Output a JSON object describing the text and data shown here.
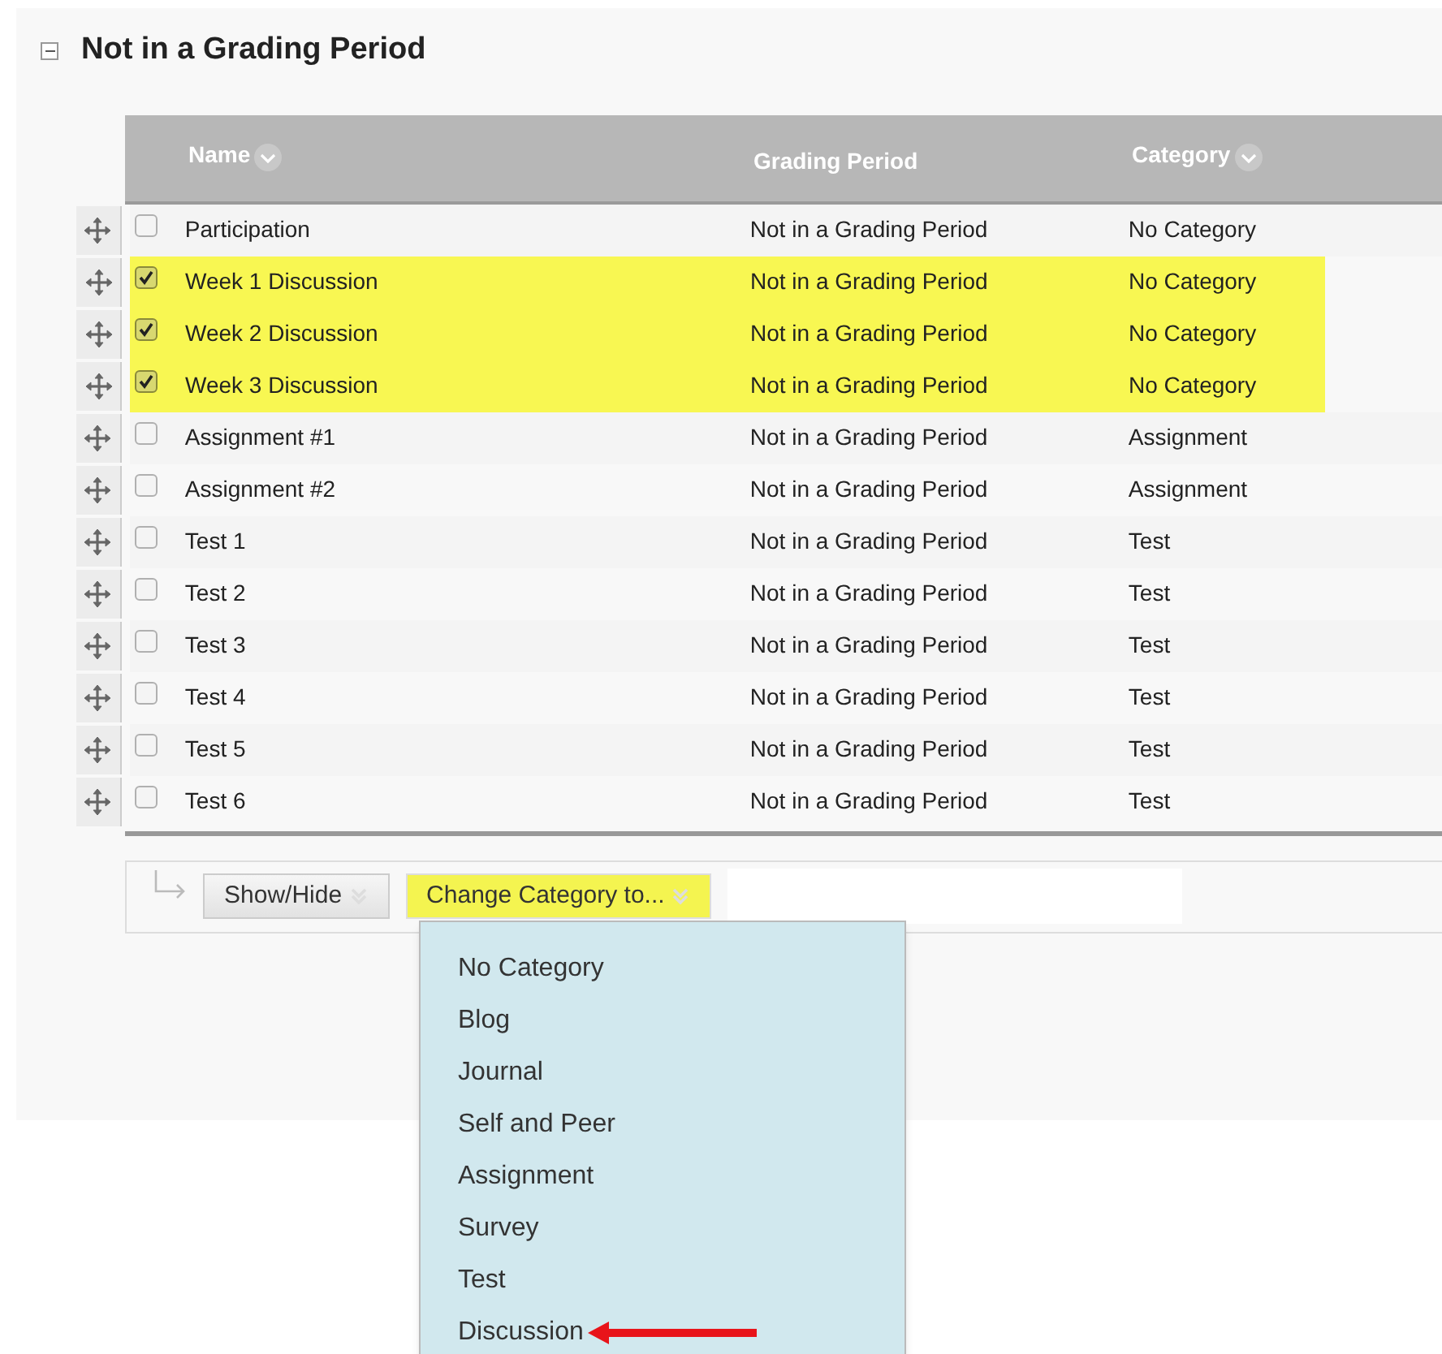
{
  "section": {
    "title": "Not in a Grading Period",
    "expanded": true
  },
  "table": {
    "columns": [
      {
        "label": "Name",
        "sortable": true
      },
      {
        "label": "Grading Period",
        "sortable": false
      },
      {
        "label": "Category",
        "sortable": true
      }
    ],
    "rows": [
      {
        "name": "Participation",
        "grading_period": "Not in a Grading Period",
        "category": "No Category",
        "selected": false
      },
      {
        "name": "Week 1 Discussion",
        "grading_period": "Not in a Grading Period",
        "category": "No Category",
        "selected": true
      },
      {
        "name": "Week 2 Discussion",
        "grading_period": "Not in a Grading Period",
        "category": "No Category",
        "selected": true
      },
      {
        "name": "Week 3 Discussion",
        "grading_period": "Not in a Grading Period",
        "category": "No Category",
        "selected": true
      },
      {
        "name": "Assignment #1",
        "grading_period": "Not in a Grading Period",
        "category": "Assignment",
        "selected": false
      },
      {
        "name": "Assignment #2",
        "grading_period": "Not in a Grading Period",
        "category": "Assignment",
        "selected": false
      },
      {
        "name": "Test 1",
        "grading_period": "Not in a Grading Period",
        "category": "Test",
        "selected": false
      },
      {
        "name": "Test 2",
        "grading_period": "Not in a Grading Period",
        "category": "Test",
        "selected": false
      },
      {
        "name": "Test 3",
        "grading_period": "Not in a Grading Period",
        "category": "Test",
        "selected": false
      },
      {
        "name": "Test 4",
        "grading_period": "Not in a Grading Period",
        "category": "Test",
        "selected": false
      },
      {
        "name": "Test 5",
        "grading_period": "Not in a Grading Period",
        "category": "Test",
        "selected": false
      },
      {
        "name": "Test 6",
        "grading_period": "Not in a Grading Period",
        "category": "Test",
        "selected": false
      }
    ]
  },
  "actions": [
    {
      "label": "Show/Hide",
      "highlighted": false
    },
    {
      "label": "Change Category to...",
      "highlighted": true
    }
  ],
  "dropdown": {
    "open": true,
    "items": [
      {
        "label": "No Category",
        "pointed": false
      },
      {
        "label": "Blog",
        "pointed": false
      },
      {
        "label": "Journal",
        "pointed": false
      },
      {
        "label": "Self and Peer",
        "pointed": false
      },
      {
        "label": "Assignment",
        "pointed": false
      },
      {
        "label": "Survey",
        "pointed": false
      },
      {
        "label": "Test",
        "pointed": false
      },
      {
        "label": "Discussion",
        "pointed": true
      }
    ]
  }
}
